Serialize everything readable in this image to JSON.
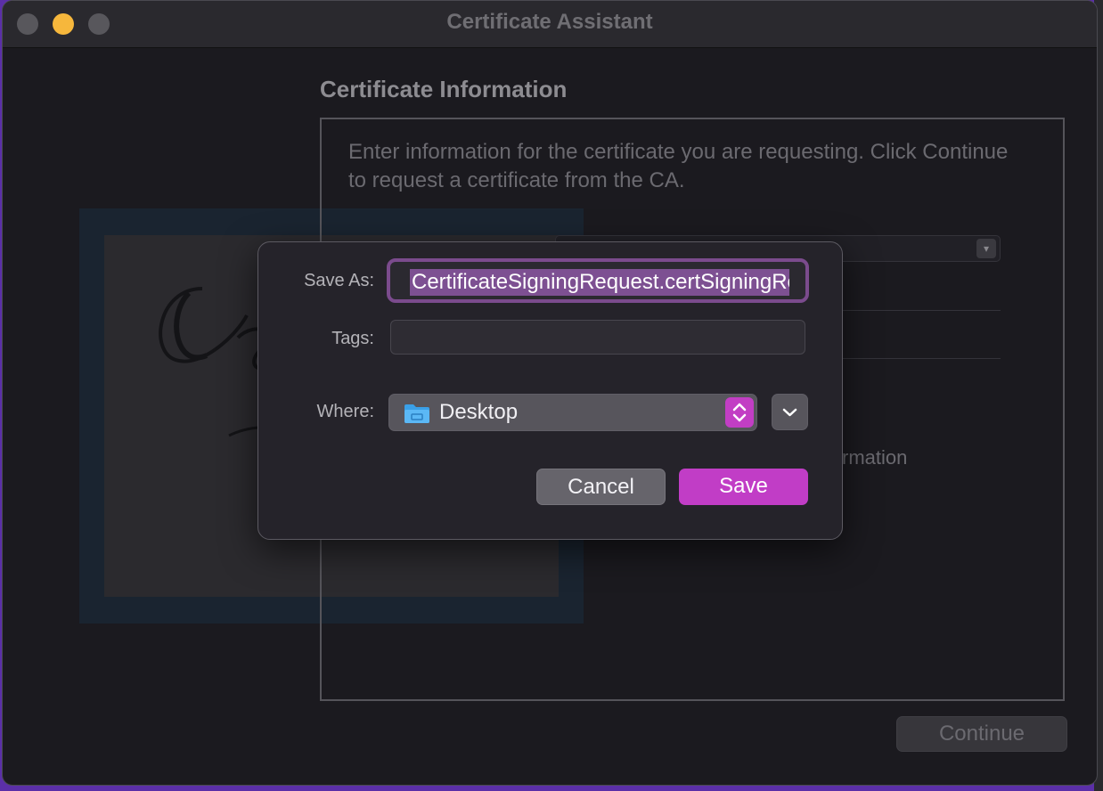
{
  "window": {
    "title": "Certificate Assistant"
  },
  "main": {
    "section_title": "Certificate Information",
    "info_text": "Enter information for the certificate you are requesting. Click Continue to request a certificate from the CA.",
    "partial_text": "rmation",
    "continue_label": "Continue"
  },
  "save_sheet": {
    "save_as_label": "Save As:",
    "save_as_value": "CertificateSigningRequest.certSigningRequest",
    "tags_label": "Tags:",
    "tags_value": "",
    "where_label": "Where:",
    "where_value": "Desktop",
    "cancel_label": "Cancel",
    "save_label": "Save"
  },
  "colors": {
    "accent": "#c13dc6",
    "selection": "#7d5092",
    "desktop": "#5b2fa8"
  },
  "icons": [
    "folder-icon",
    "up-down-arrows-icon",
    "chevron-down-icon"
  ]
}
